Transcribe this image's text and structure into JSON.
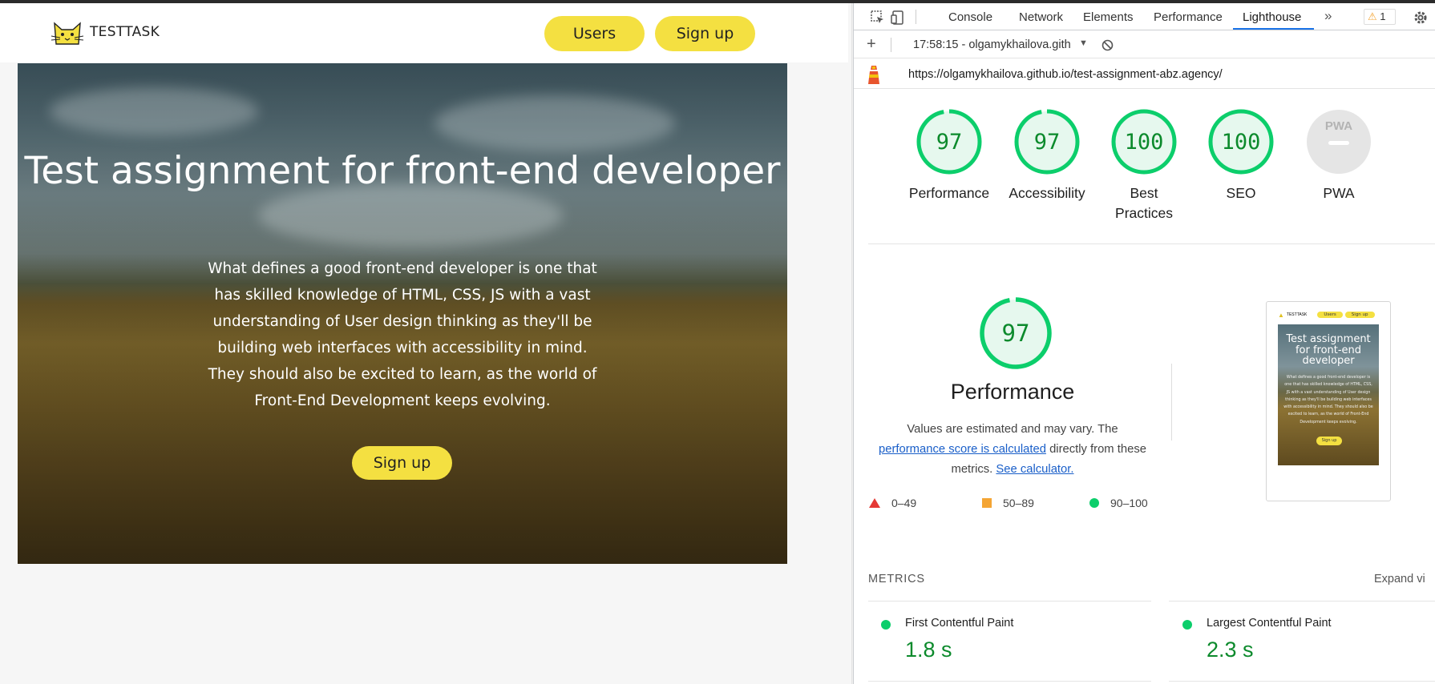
{
  "site": {
    "logo_text": "TESTTASK",
    "nav": {
      "users_label": "Users",
      "signup_label": "Sign up"
    },
    "hero": {
      "title": "Test assignment for front-end developer",
      "body": "What defines a good front-end developer is one that has skilled knowledge of HTML, CSS, JS with a vast understanding of User design thinking as they'll be building web interfaces with accessibility in mind. They should also be excited to learn, as the world of Front-End Development keeps evolving.",
      "button_label": "Sign up"
    },
    "accent_color": "#f4e041"
  },
  "devtools": {
    "tabs": [
      "Console",
      "Network",
      "Elements",
      "Performance",
      "Lighthouse"
    ],
    "active_tab": "Lighthouse",
    "more_tabs_icon": "»",
    "warning_count": "1",
    "report_selector": "17:58:15 - olgamykhailova.gith",
    "url": "https://olgamykhailova.github.io/test-assignment-abz.agency/",
    "scores": [
      {
        "label": "Performance",
        "value": "97"
      },
      {
        "label": "Accessibility",
        "value": "97"
      },
      {
        "label": "Best Practices",
        "value": "100"
      },
      {
        "label": "SEO",
        "value": "100"
      },
      {
        "label": "PWA",
        "value": "PWA"
      }
    ],
    "score_color": "#0cce6b",
    "performance_section": {
      "score": "97",
      "title": "Performance",
      "desc_prefix": "Values are estimated and may vary. The",
      "link_score": "performance score is calculated",
      "desc_middle": "directly from these metrics.",
      "link_calculator": "See calculator.",
      "legend": [
        "0–49",
        "50–89",
        "90–100"
      ]
    },
    "thumbnail": {
      "logo_text": "TESTTASK",
      "users_label": "Users",
      "signup_label": "Sign up",
      "title": "Test assignment for front-end developer",
      "body": "What defines a good front-end developer is one that has skilled knowledge of HTML, CSS, JS with a vast understanding of User design thinking as they'll be building web interfaces with accessibility in mind. They should also be excited to learn, as the world of Front-End Development keeps evolving.",
      "button_label": "Sign up"
    },
    "metrics_heading": "METRICS",
    "expand_label": "Expand vi",
    "metrics": [
      {
        "name": "First Contentful Paint",
        "value": "1.8 s"
      },
      {
        "name": "Largest Contentful Paint",
        "value": "2.3 s"
      }
    ]
  }
}
